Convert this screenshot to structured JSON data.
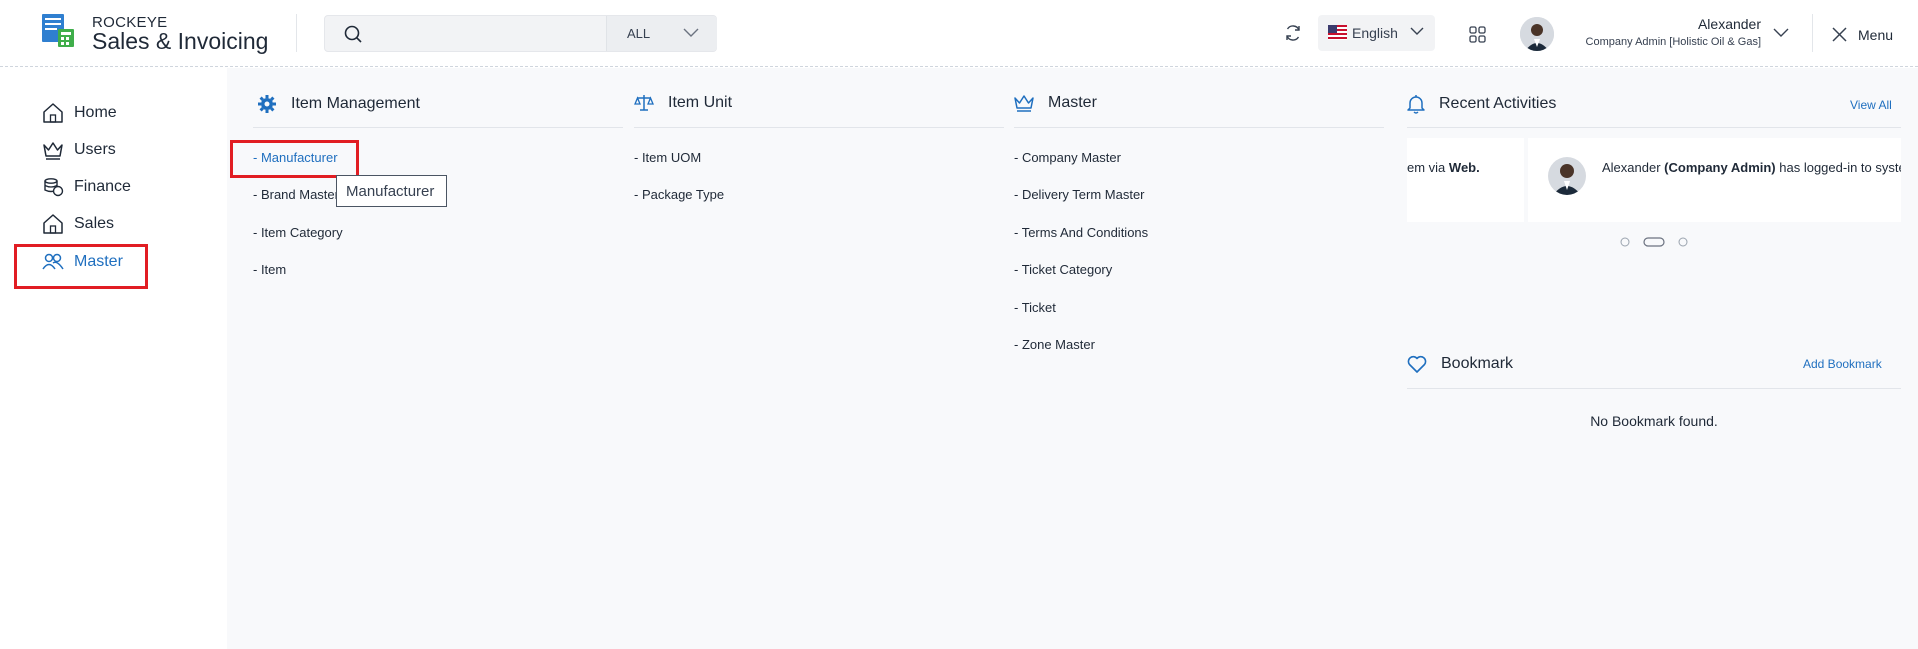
{
  "brand": {
    "top": "ROCKEYE",
    "main": "Sales & Invoicing"
  },
  "search": {
    "value": "",
    "placeholder": "",
    "scope": "ALL"
  },
  "language": "English",
  "user": {
    "name": "Alexander",
    "role": "Company Admin [Holistic Oil & Gas]"
  },
  "menu_label": "Menu",
  "sidebar": {
    "items": [
      {
        "label": "Home",
        "icon": "home-icon"
      },
      {
        "label": "Users",
        "icon": "crown-icon"
      },
      {
        "label": "Finance",
        "icon": "coins-icon"
      },
      {
        "label": "Sales",
        "icon": "home-icon"
      },
      {
        "label": "Master",
        "icon": "users-icon",
        "active": true
      }
    ]
  },
  "columns": [
    {
      "title": "Item Management",
      "icon": "gear-icon",
      "links": [
        "- Manufacturer",
        "- Brand Master",
        "- Item Category",
        "- Item"
      ],
      "active_link": "- Manufacturer"
    },
    {
      "title": "Item Unit",
      "icon": "scale-icon",
      "links": [
        "- Item UOM",
        "- Package Type"
      ]
    },
    {
      "title": "Master",
      "icon": "crown-icon",
      "links": [
        "- Company Master",
        "- Delivery Term Master",
        "- Terms And Conditions",
        "- Ticket Category",
        "- Ticket",
        "- Zone Master"
      ]
    }
  ],
  "tooltip": "Manufacturer",
  "recent": {
    "title": "Recent Activities",
    "view_all": "View All",
    "card_prev": {
      "prefix": "em via ",
      "bold": "Web."
    },
    "card_current": {
      "name": "Alexander",
      "bold": "(Company Admin)",
      "suffix": " has logged-in to syste"
    },
    "pages": 3,
    "active_page": 2
  },
  "bookmark": {
    "title": "Bookmark",
    "add": "Add Bookmark",
    "empty": "No Bookmark found."
  },
  "colors": {
    "accent": "#1f6fbf",
    "highlight": "#e11d23",
    "content_bg": "#f8f9fb"
  }
}
